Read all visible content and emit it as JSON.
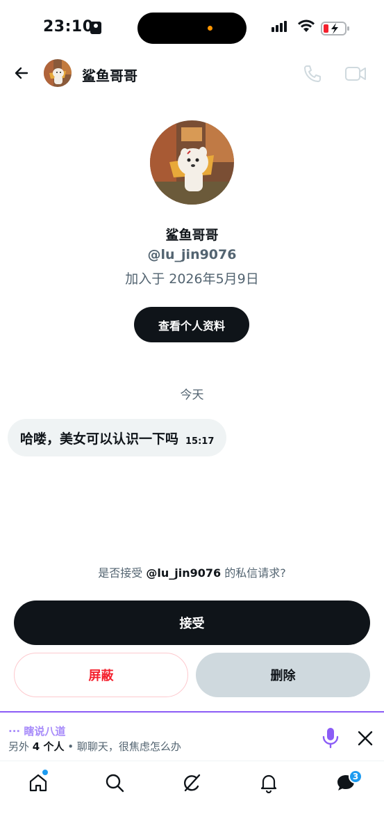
{
  "status_bar": {
    "time": "23:10"
  },
  "header": {
    "name": "鲨鱼哥哥"
  },
  "profile": {
    "name": "鲨鱼哥哥",
    "handle": "@lu_jin9076",
    "joined": "加入于 2026年5月9日",
    "view_profile_label": "查看个人资料"
  },
  "chat": {
    "date_separator": "今天",
    "messages": [
      {
        "text": "哈喽，美女可以认识一下吗",
        "time": "15:17"
      }
    ]
  },
  "request": {
    "prompt_prefix": "是否接受",
    "prompt_handle": "@lu_jin9076",
    "prompt_suffix": "的私信请求?",
    "accept_label": "接受",
    "block_label": "屏蔽",
    "delete_label": "删除"
  },
  "spaces_banner": {
    "title": "··· 瞎说八道",
    "subtitle_prefix": "另外",
    "subtitle_count": "4 个人",
    "subtitle_suffix": "• 聊聊天，很焦虑怎么办"
  },
  "nav": {
    "items": [
      "home-icon",
      "search-icon",
      "grok-icon",
      "bell-icon",
      "messages-icon"
    ],
    "messages_badge": "3"
  },
  "colors": {
    "primary": "#0f1419",
    "secondary_text": "#536471",
    "danger": "#f4212e",
    "accent_blue": "#1d9bf0",
    "spaces_purple": "#8b5cf6"
  }
}
